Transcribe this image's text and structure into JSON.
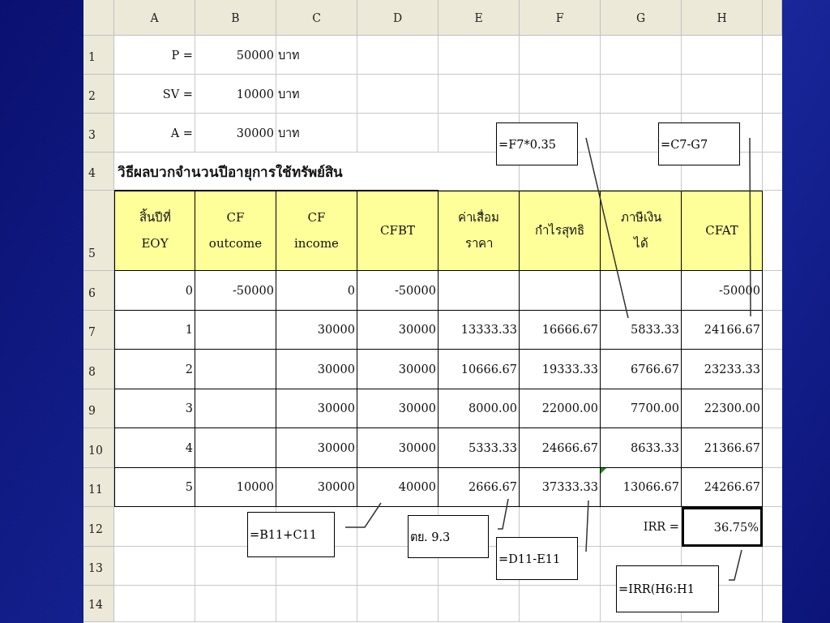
{
  "sheet": {
    "columns": [
      "A",
      "B",
      "C",
      "D",
      "E",
      "F",
      "G",
      "H"
    ],
    "rows": [
      {
        "number": "1",
        "kind": "plain",
        "cells": [
          "P =",
          "50000",
          "บาท",
          null,
          null,
          null,
          null,
          null
        ]
      },
      {
        "number": "2",
        "kind": "plain",
        "cells": [
          "SV =",
          "10000",
          "บาท",
          null,
          null,
          null,
          null,
          null
        ]
      },
      {
        "number": "3",
        "kind": "plain",
        "cells": [
          "A =",
          "30000",
          "บาท",
          null,
          null,
          null,
          null,
          null
        ]
      },
      {
        "number": "4",
        "kind": "title",
        "title": "วิธีผลบวกจำนวนปีอายุการใช้ทรัพย์สิน"
      },
      {
        "number": "5",
        "kind": "header",
        "cells": [
          {
            "lines": [
              "สิ้นปีที่",
              "EOY"
            ]
          },
          {
            "lines": [
              "CF",
              "outcome"
            ]
          },
          {
            "lines": [
              "CF",
              "income"
            ]
          },
          {
            "lines": [
              "CFBT"
            ]
          },
          {
            "lines": [
              "ค่าเสื่อม",
              "ราคา"
            ]
          },
          {
            "lines": [
              "กำไรสุทธิ"
            ]
          },
          {
            "lines": [
              "ภาษีเงิน",
              "ได้"
            ]
          },
          {
            "lines": [
              "CFAT"
            ]
          }
        ]
      },
      {
        "number": "6",
        "kind": "data",
        "cells": [
          "0",
          "-50000",
          "0",
          "-50000",
          null,
          null,
          null,
          "-50000"
        ]
      },
      {
        "number": "7",
        "kind": "data",
        "cells": [
          "1",
          null,
          "30000",
          "30000",
          "13333.33",
          "16666.67",
          "5833.33",
          "24166.67"
        ]
      },
      {
        "number": "8",
        "kind": "data",
        "cells": [
          "2",
          null,
          "30000",
          "30000",
          "10666.67",
          "19333.33",
          "6766.67",
          "23233.33"
        ]
      },
      {
        "number": "9",
        "kind": "data",
        "cells": [
          "3",
          null,
          "30000",
          "30000",
          "8000.00",
          "22000.00",
          "7700.00",
          "22300.00"
        ]
      },
      {
        "number": "10",
        "kind": "data",
        "cells": [
          "4",
          null,
          "30000",
          "30000",
          "5333.33",
          "24666.67",
          "8633.33",
          "21366.67"
        ]
      },
      {
        "number": "11",
        "kind": "data",
        "cells": [
          "5",
          "10000",
          "30000",
          "40000",
          "2666.67",
          "37333.33",
          {
            "text": "13066.67",
            "flagged": true
          },
          "24266.67"
        ]
      },
      {
        "number": "12",
        "kind": "plain",
        "cells": [
          null,
          null,
          null,
          null,
          null,
          null,
          "IRR =",
          {
            "text": "36.75%",
            "selected": true
          }
        ]
      },
      {
        "number": "13",
        "kind": "plain",
        "cells": [
          null,
          null,
          null,
          null,
          null,
          null,
          null,
          null
        ]
      },
      {
        "number": "14",
        "kind": "plain",
        "cells": [
          null,
          null,
          null,
          null,
          null,
          null,
          null,
          null
        ]
      }
    ],
    "callouts": [
      {
        "text": "=F7*0.35"
      },
      {
        "text": "=C7-G7"
      },
      {
        "text": "=B11+C11"
      },
      {
        "text": "ตย. 9.3"
      },
      {
        "text": "=D11-E11"
      },
      {
        "text": "=IRR(H6:H1"
      }
    ]
  }
}
